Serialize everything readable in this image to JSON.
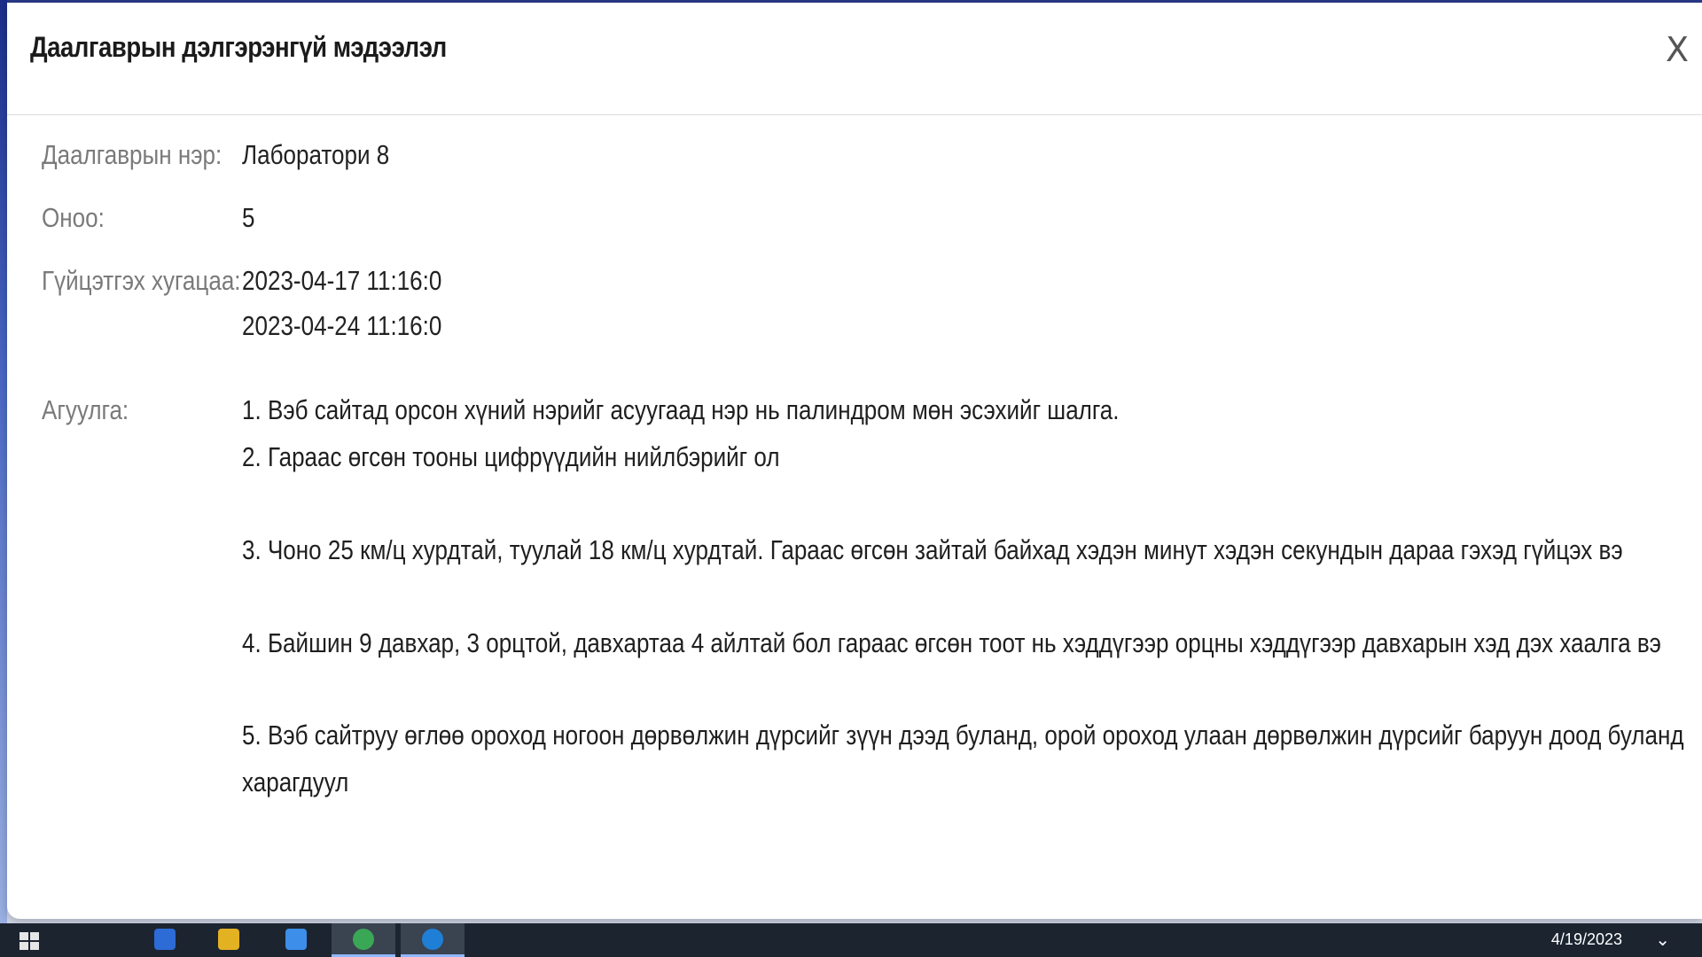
{
  "modal": {
    "title": "Даалгаврын дэлгэрэнгүй мэдээлэл",
    "close_label": "X"
  },
  "fields": {
    "name_label": "Даалгаврын нэр:",
    "name_value": "Лаборатори 8",
    "score_label": "Оноо:",
    "score_value": "5",
    "duration_label": "Гүйцэтгэх хугацаа:",
    "start": "2023-04-17 11:16:0",
    "end": "2023-04-24 11:16:0",
    "content_label": "Агуулга:"
  },
  "content": [
    "1. Вэб сайтад орсон хүний нэрийг асуугаад нэр нь палиндром мөн эсэхийг шалга.",
    "2. Гараас өгсөн тооны цифрүүдийн нийлбэрийг ол",
    "3. Чоно 25 км/ц хурдтай, туулай 18 км/ц хурдтай. Гараас өгсөн зайтай байхад хэдэн минут хэдэн секундын дараа гэхэд гүйцэх вэ",
    "4. Байшин 9 давхар, 3 орцтой, давхартаа 4 айлтай бол гараас өгсөн тоот нь хэддүгээр орцны хэддүгээр давхарын хэд дэх хаалга вэ",
    "5. Вэб сайтруу өглөө ороход ногоон дөрвөлжин дүрсийг зүүн дээд буланд, орой ороход улаан дөрвөлжин дүрсийг баруун доод буланд",
    "харагдуул"
  ],
  "taskbar": {
    "date": "4/19/2023"
  },
  "colors": {
    "accent": "#8fb8ff",
    "taskbar": "#1c2430"
  }
}
